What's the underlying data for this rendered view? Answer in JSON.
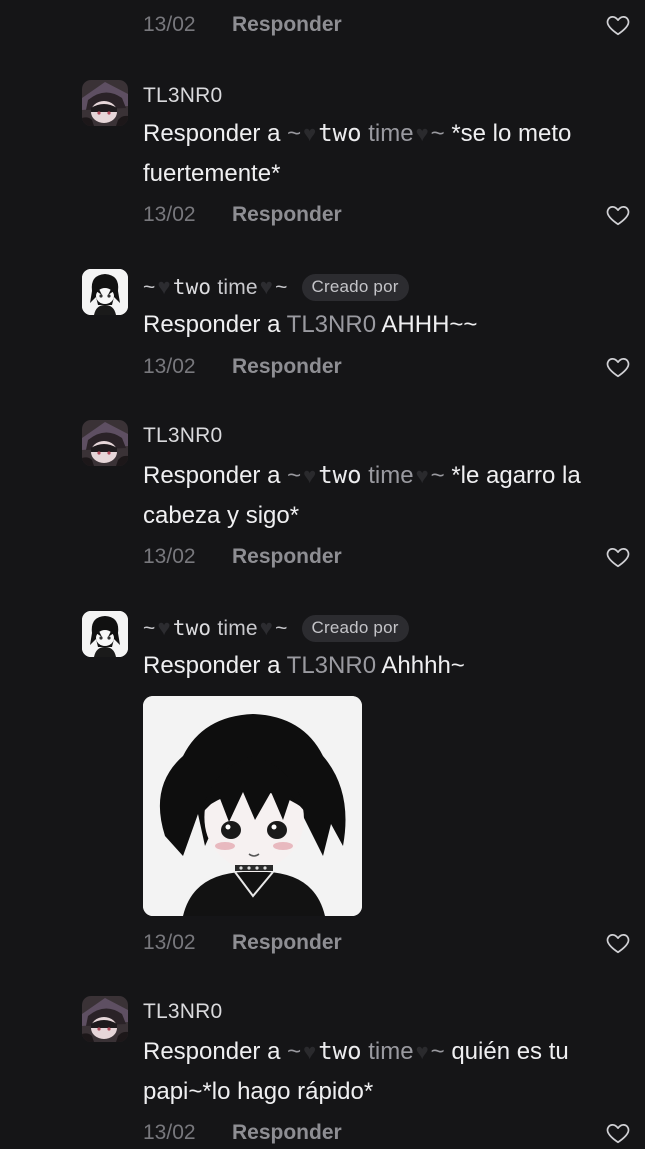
{
  "labels": {
    "reply": "Responder",
    "reply_to_prefix": "Responder a",
    "created_by": "Creado por"
  },
  "names": {
    "user_a": "TL3NR0",
    "user_b_prefix": "~",
    "user_b_two": "two",
    "user_b_time": "time",
    "user_b_suffix": "~"
  },
  "comments": [
    {
      "date": "13/02"
    },
    {
      "author": "TL3NR0",
      "reply_to": "~🖤two time🖤~",
      "text_line1": "*se lo meto",
      "text_line2": "fuertemente*",
      "date": "13/02"
    },
    {
      "author": "~🖤two time🖤~",
      "reply_to": "TL3NR0",
      "text": "AHHH~~",
      "date": "13/02"
    },
    {
      "author": "TL3NR0",
      "reply_to": "~🖤two time🖤~",
      "text_line1": "*le agarro la",
      "text_line2": "cabeza y sigo*",
      "date": "13/02"
    },
    {
      "author": "~🖤two time🖤~",
      "reply_to": "TL3NR0",
      "text": "Ahhhh~",
      "has_image": true,
      "date": "13/02"
    },
    {
      "author": "TL3NR0",
      "reply_to": "~🖤two time🖤~",
      "text_line1": "quién es tu",
      "text_line2": "papi~*lo hago rápido*",
      "date": "13/02"
    }
  ],
  "colors": {
    "background": "#151517",
    "text": "#efeff1",
    "muted": "#78787d",
    "badge_bg": "#2c2c30"
  }
}
